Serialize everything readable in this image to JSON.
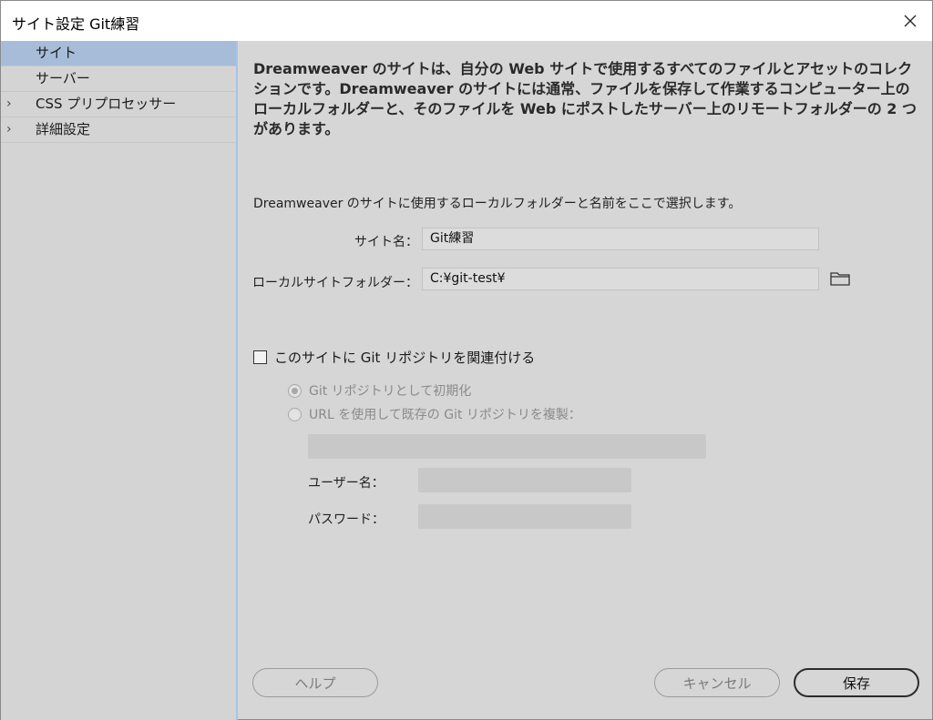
{
  "window": {
    "title": "サイト設定 Git練習"
  },
  "sidebar": {
    "items": [
      {
        "label": "サイト"
      },
      {
        "label": "サーバー"
      },
      {
        "label": "CSS プリプロセッサー",
        "chevron": "›"
      },
      {
        "label": "詳細設定",
        "chevron": "›"
      }
    ]
  },
  "main": {
    "intro": "Dreamweaver のサイトは、自分の Web サイトで使用するすべてのファイルとアセットのコレクションです。Dreamweaver のサイトには通常、ファイルを保存して作業するコンピューター上のローカルフォルダーと、そのファイルを Web にポストしたサーバー上のリモートフォルダーの 2 つがあります。",
    "sub_intro": "Dreamweaver のサイトに使用するローカルフォルダーと名前をここで選択します。",
    "site_name_label": "サイト名：",
    "site_name_value": "Git練習",
    "local_folder_label": "ローカルサイトフォルダー：",
    "local_folder_value": "C:¥git-test¥",
    "folder_icon": "folder-icon",
    "git_checkbox_label": "このサイトに Git リポジトリを関連付ける",
    "radio_init_label": "Git リポジトリとして初期化",
    "radio_clone_label": "URL を使用して既存の Git リポジトリを複製：",
    "username_label": "ユーザー名：",
    "password_label": "パスワード："
  },
  "buttons": {
    "help": "ヘルプ",
    "cancel": "キャンセル",
    "save": "保存"
  },
  "colors": {
    "selected_item": "#a6bcd8",
    "background": "#d6d6d6"
  }
}
